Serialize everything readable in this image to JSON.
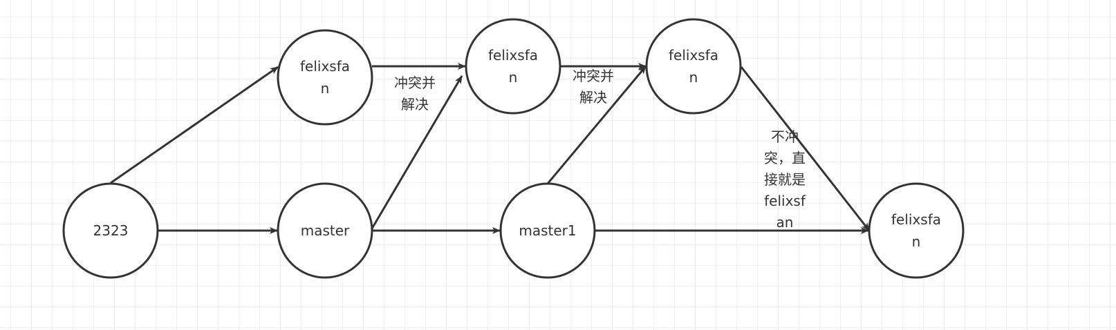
{
  "nodes": [
    {
      "id": "n2323",
      "lines": [
        "2323"
      ]
    },
    {
      "id": "f1",
      "lines": [
        "felixsfa",
        "n"
      ]
    },
    {
      "id": "master",
      "lines": [
        "master"
      ]
    },
    {
      "id": "f2",
      "lines": [
        "felixsfa",
        "n"
      ]
    },
    {
      "id": "f3",
      "lines": [
        "felixsfa",
        "n"
      ]
    },
    {
      "id": "master1",
      "lines": [
        "master1"
      ]
    },
    {
      "id": "f4",
      "lines": [
        "felixsfa",
        "n"
      ]
    }
  ],
  "edges": [
    {
      "from": "n2323",
      "to": "f1"
    },
    {
      "from": "n2323",
      "to": "master"
    },
    {
      "from": "f1",
      "to": "f2",
      "label": [
        "冲突并",
        "解决"
      ]
    },
    {
      "from": "master",
      "to": "f2"
    },
    {
      "from": "master",
      "to": "master1"
    },
    {
      "from": "f2",
      "to": "f3",
      "label": [
        "冲突并",
        "解决"
      ]
    },
    {
      "from": "master1",
      "to": "f3"
    },
    {
      "from": "f3",
      "to": "f4",
      "label": [
        "不冲",
        "突，直",
        "接就是",
        "felixsf",
        "an"
      ]
    },
    {
      "from": "master1",
      "to": "f4"
    }
  ],
  "colors": {
    "stroke": "#333333",
    "grid": "#ebebeb"
  }
}
